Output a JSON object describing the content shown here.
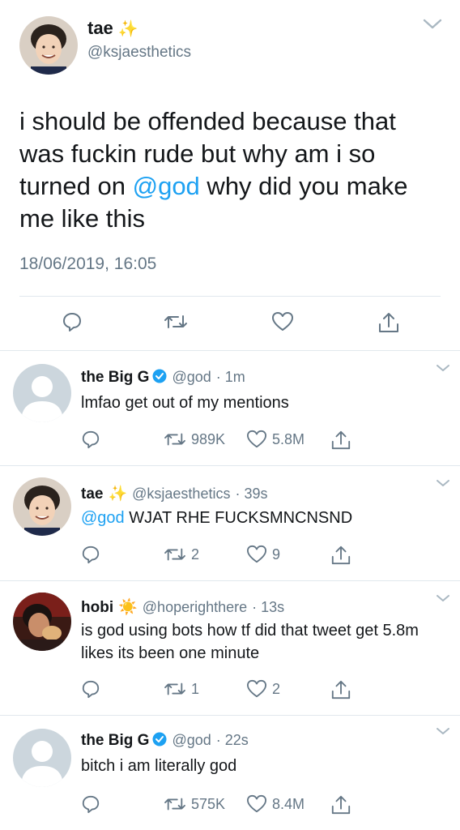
{
  "main": {
    "name": "tae",
    "name_emoji": "✨",
    "handle": "@ksjaesthetics",
    "text_before": "i should be offended because that was fuckin rude but why am i so turned on ",
    "mention": "@god",
    "text_after": " why did you make me like this",
    "timestamp": "18/06/2019, 16:05"
  },
  "replies": [
    {
      "name": "the Big G",
      "handle": "@god",
      "time": "· 1m",
      "verified": true,
      "text": "lmfao get out of my mentions",
      "retweets": "989K",
      "likes": "5.8M"
    },
    {
      "name": "tae",
      "name_emoji": "✨",
      "handle": "@ksjaesthetics",
      "time": "· 39s",
      "mention": "@god",
      "text": " WJAT RHE FUCKSMNCNSND",
      "retweets": "2",
      "likes": "9"
    },
    {
      "name": "hobi",
      "name_emoji": "☀️",
      "handle": "@hoperighthere",
      "time": "· 13s",
      "text": "is god using bots how tf did that tweet get 5.8m likes its been one minute",
      "retweets": "1",
      "likes": "2"
    },
    {
      "name": "the Big G",
      "handle": "@god",
      "time": "· 22s",
      "verified": true,
      "text": "bitch i am literally god",
      "retweets": "575K",
      "likes": "8.4M"
    }
  ],
  "colors": {
    "text": "#14171a",
    "secondary": "#657786",
    "link": "#1da1f2",
    "divider": "#e1e8ed"
  }
}
